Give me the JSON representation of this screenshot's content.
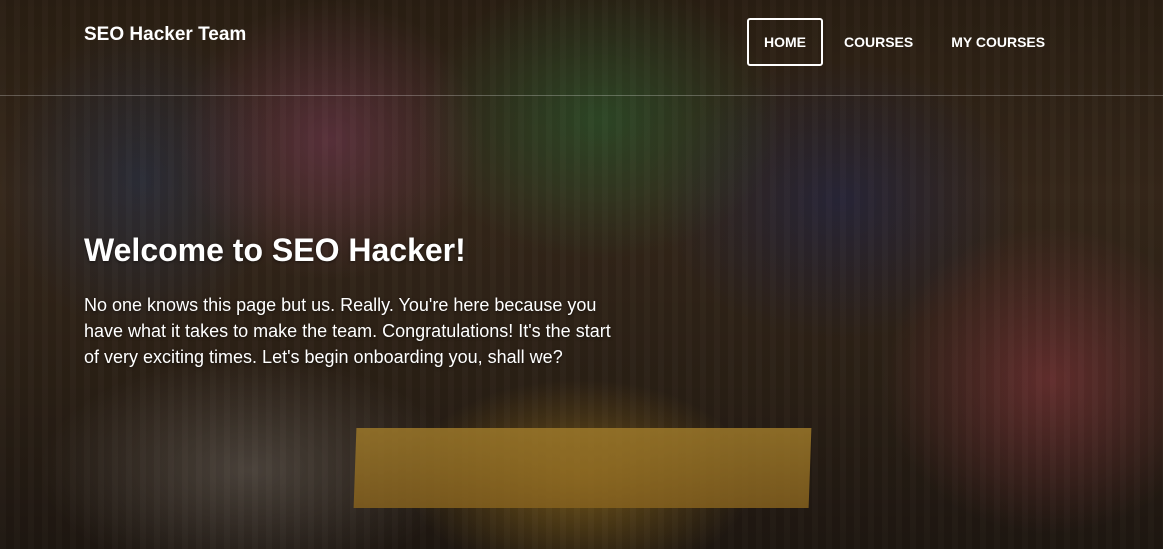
{
  "brand": {
    "name": "SEO Hacker Team"
  },
  "nav": {
    "items": [
      {
        "label": "HOME",
        "active": true
      },
      {
        "label": "COURSES",
        "active": false
      },
      {
        "label": "MY COURSES",
        "active": false
      }
    ]
  },
  "hero": {
    "title": "Welcome to SEO Hacker!",
    "body": "No one knows this page but us. Really. You're here because you have what it takes to make the team. Congratulations! It's the start of very exciting times. Let's begin onboarding you, shall we?",
    "background_image": "group-photo"
  }
}
